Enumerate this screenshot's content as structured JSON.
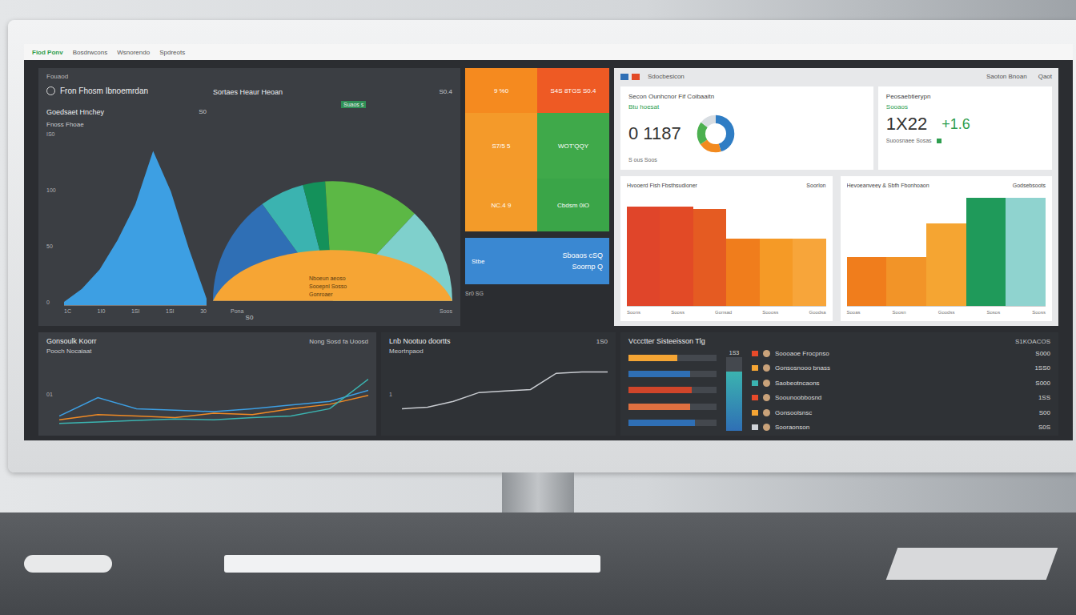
{
  "top_bar": {
    "logo": "Fiod Ponv",
    "links": [
      "Bosdrwcons",
      "Wsnorendo",
      "Spdreots"
    ]
  },
  "overview": {
    "label": "Fouaod",
    "title": "Fron Fhosm Ibnoemrdan",
    "status": "S0"
  },
  "area_chart": {
    "title": "Goedsaet Hnchey",
    "value": "S0",
    "legend": "Fnoss Fhoae",
    "y_ticks": [
      "IS0",
      "100",
      "50",
      "0"
    ],
    "x_ticks": [
      "1C",
      "1I0",
      "1SI",
      "1SI",
      "30"
    ],
    "values": [
      2,
      10,
      22,
      40,
      62,
      95,
      70,
      35,
      4
    ],
    "color": "#3d9fe3"
  },
  "pie_chart": {
    "title": "Sortaes Heaur Heoan",
    "badge": "S0.4",
    "callout": "Suaos s",
    "slices": [
      {
        "value": 30,
        "color": "#2f6fb5"
      },
      {
        "value": 12,
        "color": "#3bb3b0"
      },
      {
        "value": 6,
        "color": "#14915a"
      },
      {
        "value": 26,
        "color": "#5cb845"
      },
      {
        "value": 26,
        "color": "#7fd0cc"
      }
    ],
    "base": {
      "color": "#f6a534",
      "labels": [
        "Nboeun aeoso",
        "Sooepnl Sosso",
        "Gonroaer"
      ]
    },
    "axis": [
      "Pona",
      "Soos"
    ]
  },
  "treemap": {
    "tiles": [
      {
        "label": "9 %0",
        "color": "#f58a1f"
      },
      {
        "label": "S4S 8TGS S0.4",
        "color": "#ee5a24"
      },
      {
        "label": "S7/5 5",
        "color": "#f49a2a"
      },
      {
        "label": "WOT'QQY",
        "color": "#3fa94a"
      },
      {
        "label": "NC.4 9",
        "color": "#f39b29"
      },
      {
        "label": "Cbdsm 0iO",
        "color": "#3aa548"
      }
    ],
    "footer": "Sr0 SG"
  },
  "blue_tile": {
    "badge": "Stbe",
    "title": "Sboaos cSQ",
    "subtitle": "Soornp Q",
    "color": "#3a88d2"
  },
  "summary": {
    "logo": "Sdocbesicon",
    "links": [
      "Saoton Bnoan",
      "Qaot"
    ],
    "kpis": [
      {
        "kind": "donut",
        "title": "Secon Ounhcnor Fif Coibaaitn",
        "label": "Btu hoesat",
        "value": "0 1187",
        "footer": "S ous Soos",
        "donut": [
          {
            "value": 45,
            "color": "#2f7dc4"
          },
          {
            "value": 20,
            "color": "#f28a1f"
          },
          {
            "value": 20,
            "color": "#4cb050"
          },
          {
            "value": 15,
            "color": "#d8dde2"
          }
        ]
      },
      {
        "kind": "delta",
        "title": "Peosaebtierypn",
        "label": "Sooaos",
        "value": "1X22",
        "delta": "+1.6",
        "footer": "Suoosnaee Sosas"
      }
    ],
    "bar_charts": [
      {
        "title": "Hvooerd Fish Fbsthsudioner",
        "tag": "Soorlon",
        "x_ticks": [
          "Soons",
          "Sooss",
          "Gonsad",
          "Soooss",
          "Goodsa"
        ],
        "bars": [
          {
            "value": 92,
            "color": "#e0452a"
          },
          {
            "value": 92,
            "color": "#e24a26"
          },
          {
            "value": 90,
            "color": "#e55b22"
          },
          {
            "value": 62,
            "color": "#f07d1c"
          },
          {
            "value": 62,
            "color": "#f59a26"
          },
          {
            "value": 62,
            "color": "#f7a53a"
          }
        ]
      },
      {
        "title": "Hevoeanveey & Sbfh Fbonhoaon",
        "tag": "Godsebsoots",
        "x_ticks": [
          "Sooas",
          "Soosn",
          "Goodss",
          "Sosos",
          "Sooss"
        ],
        "bars": [
          {
            "value": 45,
            "color": "#f07d1c"
          },
          {
            "value": 45,
            "color": "#f29428"
          },
          {
            "value": 76,
            "color": "#f5a532"
          },
          {
            "value": 100,
            "color": "#1f9a5a"
          },
          {
            "value": 100,
            "color": "#8fd3cf"
          }
        ]
      }
    ]
  },
  "line_charts": [
    {
      "title": "Gonsoulk Koorr",
      "subtitle": "Pooch Nocaiaat",
      "note": "Nong Sosd fa Uoosd",
      "tick": "01",
      "series": [
        {
          "color": "#3d9fe3",
          "values": [
            20,
            45,
            30,
            28,
            26,
            30,
            35,
            40,
            55
          ]
        },
        {
          "color": "#f08a24",
          "values": [
            15,
            22,
            20,
            18,
            24,
            22,
            30,
            36,
            48
          ]
        },
        {
          "color": "#3bb3b0",
          "values": [
            10,
            12,
            14,
            16,
            15,
            18,
            20,
            30,
            70
          ]
        }
      ]
    },
    {
      "title": "Lnb Nootuo doortts",
      "subtitle": "Meortnpaod",
      "note": "1S0",
      "tick": "1",
      "series": [
        {
          "color": "#c9ccd1",
          "values": [
            30,
            32,
            40,
            52,
            54,
            56,
            78,
            80,
            80
          ]
        }
      ]
    }
  ],
  "list_panel": {
    "title": "Vccctter Sisteeisson Tlg",
    "value": "S1KOACOS",
    "gauge": {
      "level": 0.8,
      "value": "1S3"
    },
    "bars": [
      {
        "level": 0.55,
        "color": "#f5a534"
      },
      {
        "level": 0.7,
        "color": "#2f6fb5"
      },
      {
        "level": 0.72,
        "color": "#d0452a"
      },
      {
        "level": 0.7,
        "color": "#e07040"
      },
      {
        "level": 0.75,
        "color": "#2f6fb5"
      }
    ],
    "rows": [
      {
        "label": "Soooaoe Frocpnso",
        "value": "S000",
        "color": "#e84a2a"
      },
      {
        "label": "Gonsosnooo bnass",
        "value": "1SS0",
        "color": "#f5a534"
      },
      {
        "label": "Saobeotncaons",
        "value": "S000",
        "color": "#3bb3b0"
      },
      {
        "label": "Soounoobbosnd",
        "value": "1SS",
        "color": "#e84a2a"
      },
      {
        "label": "Gonsoolsnsc",
        "value": "S00",
        "color": "#f5a534"
      },
      {
        "label": "Sooraonson",
        "value": "S0S",
        "color": "#d0d3d8"
      }
    ]
  }
}
